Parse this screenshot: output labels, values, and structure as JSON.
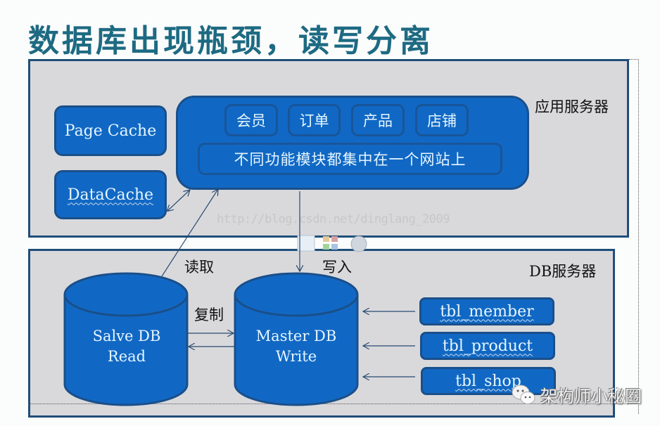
{
  "title": "数据库出现瓶颈，读写分离",
  "app_server": {
    "label": "应用服务器",
    "caches": [
      "Page Cache",
      "DataCache"
    ],
    "modules": [
      "会员",
      "订单",
      "产品",
      "店铺"
    ],
    "all_in_one": "不同功能模块都集中在一个网站上"
  },
  "db_server": {
    "label": "DB服务器",
    "slave": {
      "line1": "Salve DB",
      "line2": "Read"
    },
    "master": {
      "line1": "Master DB",
      "line2": "Write"
    },
    "tables": [
      "tbl_member",
      "tbl_product",
      "tbl_shop"
    ]
  },
  "edges": {
    "read": "读取",
    "write": "写入",
    "replicate": "复制"
  },
  "watermark": "http://blog.csdn.net/dinglang_2009",
  "signature": "架构师小秘圈",
  "colors": {
    "box_fill": "#1168c4",
    "box_border": "#1a4f8a",
    "panel_fill": "#d9d9dc",
    "panel_border": "#1f4e79",
    "title": "#1d6a82"
  }
}
